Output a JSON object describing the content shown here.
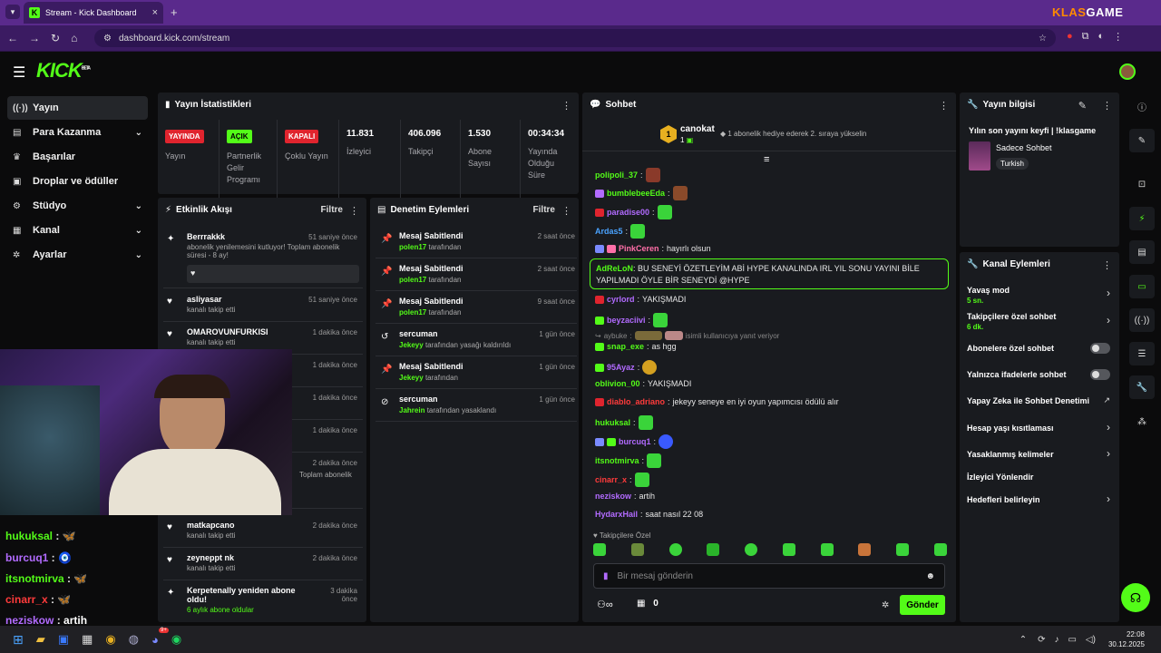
{
  "browser": {
    "tab_title": "Stream - Kick Dashboard",
    "url": "dashboard.kick.com/stream",
    "watermark_a": "KLAS",
    "watermark_b": "GAME"
  },
  "brand": {
    "logo": "KICK",
    "beta": "BETA",
    "accent": "#53fc18"
  },
  "sidebar": {
    "items": [
      {
        "label": "Yayın",
        "icon": "broadcast-icon"
      },
      {
        "label": "Para Kazanma",
        "icon": "money-icon"
      },
      {
        "label": "Başarılar",
        "icon": "trophy-icon"
      },
      {
        "label": "Droplar ve ödüller",
        "icon": "gift-icon"
      },
      {
        "label": "Stüdyo",
        "icon": "studio-icon"
      },
      {
        "label": "Kanal",
        "icon": "channel-icon"
      },
      {
        "label": "Ayarlar",
        "icon": "gear-icon"
      }
    ]
  },
  "stats": {
    "title": "Yayın İstatistikleri",
    "live_badge": "YAYINDA",
    "live_label": "Yayın",
    "partner_badge": "AÇIK",
    "partner_label": "Partnerlik Gelir Programı",
    "multi_badge": "KAPALI",
    "multi_label": "Çoklu Yayın",
    "viewers": "11.831",
    "viewers_label": "İzleyici",
    "followers": "406.096",
    "followers_label": "Takipçi",
    "subs": "1.530",
    "subs_label": "Abone Sayısı",
    "uptime": "00:34:34",
    "uptime_label": "Yayında Olduğu Süre"
  },
  "activity": {
    "title": "Etkinlik Akışı",
    "filter": "Filtre",
    "rows": [
      {
        "name": "Berrrakkk",
        "sub": "abonelik yenilemesini kutluyor! Toplam abonelik süresi - 8 ay!",
        "time": "51 saniye önce"
      },
      {
        "name": "asliyasar",
        "sub": "kanalı takip etti",
        "time": "51 saniye önce"
      },
      {
        "name": "OMAROVUNFURKISI",
        "sub": "kanalı takip etti",
        "time": "1 dakika önce"
      },
      {
        "name": "",
        "sub": "",
        "time": "1 dakika önce"
      },
      {
        "name": "",
        "sub": "",
        "time": "1 dakika önce"
      },
      {
        "name": "",
        "sub": "",
        "time": "1 dakika önce"
      },
      {
        "name": "",
        "sub": "Toplam abonelik",
        "time": "2 dakika önce"
      },
      {
        "name": "matkapcano",
        "sub": "kanalı takip etti",
        "time": "2 dakika önce"
      },
      {
        "name": "zeyneppt nk",
        "sub": "kanalı takip etti",
        "time": "2 dakika önce"
      },
      {
        "name": "Kerpetenally yeniden abone oldu!",
        "sub": "6 aylık abone oldular",
        "time": "3 dakika önce"
      }
    ]
  },
  "moderation": {
    "title": "Denetim Eylemleri",
    "filter": "Filtre",
    "rows": [
      {
        "name": "Mesaj Sabitlendi",
        "by": "polen17",
        "rest": "tarafından",
        "time": "2 saat önce"
      },
      {
        "name": "Mesaj Sabitlendi",
        "by": "polen17",
        "rest": "tarafından",
        "time": "2 saat önce"
      },
      {
        "name": "Mesaj Sabitlendi",
        "by": "polen17",
        "rest": "tarafından",
        "time": "9 saat önce"
      },
      {
        "name": "sercuman",
        "by": "Jekeyy",
        "rest": "tarafından yasağı kaldırıldı",
        "time": "1 gün önce"
      },
      {
        "name": "Mesaj Sabitlendi",
        "by": "Jekeyy",
        "rest": "tarafından",
        "time": "1 gün önce"
      },
      {
        "name": "sercuman",
        "by": "Jahrein",
        "rest": "tarafından yasaklandı",
        "time": "1 gün önce"
      }
    ]
  },
  "chat": {
    "title": "Sohbet",
    "gifter": "canokat",
    "gifter_count": "1",
    "gift_rank": "1",
    "gift_note": "1 abonelik hediye ederek 2. sıraya yükselin",
    "messages": [
      {
        "user": "polipoli_37",
        "color": "#53fc18",
        "text": ""
      },
      {
        "user": "bumblebeeEda",
        "color": "#53fc18",
        "text": ""
      },
      {
        "user": "paradise00",
        "color": "#b26bff",
        "text": ""
      },
      {
        "user": "Ardas5",
        "color": "#4aa3ff",
        "text": ""
      },
      {
        "user": "PinkCeren",
        "color": "#ff6fa8",
        "text": "hayırlı olsun"
      },
      {
        "user": "AdReLoN",
        "color": "#53fc18",
        "text": "BU SENEYİ ÖZETLEYİM ABİ HYPE KANALINDA IRL YIL SONU YAYINI BİLE YAPILMADI ÖYLE BİR SENEYDİ @HYPE"
      },
      {
        "user": "cyrlord",
        "color": "#b26bff",
        "text": "YAKIŞMADI"
      },
      {
        "user": "beyzaciivi",
        "color": "#b26bff",
        "text": ""
      },
      {
        "user": "aybuke",
        "color": "#888888",
        "text": "isimli kullanıcıya yanıt veriyor"
      },
      {
        "user": "snap_exe",
        "color": "#53fc18",
        "text": "as hgg"
      },
      {
        "user": "95Ayaz",
        "color": "#b26bff",
        "text": ""
      },
      {
        "user": "oblivion_00",
        "color": "#53fc18",
        "text": "YAKIŞMADI"
      },
      {
        "user": "diablo_adriano",
        "color": "#ff3b3b",
        "text": "jekeyy seneye en iyi oyun yapımcısı ödülü alır"
      },
      {
        "user": "hukuksal",
        "color": "#53fc18",
        "text": ""
      },
      {
        "user": "burcuq1",
        "color": "#b26bff",
        "text": ""
      },
      {
        "user": "itsnotmirva",
        "color": "#53fc18",
        "text": ""
      },
      {
        "user": "cinarr_x",
        "color": "#ff3b3b",
        "text": ""
      },
      {
        "user": "neziskow",
        "color": "#b26bff",
        "text": "artih"
      },
      {
        "user": "HydarxHail",
        "color": "#b26bff",
        "text": "saat nasıl 22 08"
      }
    ],
    "followers_only": "Takipçilere Özel",
    "placeholder": "Bir mesaj gönderin",
    "points": "0",
    "send": "Gönder"
  },
  "stream_info": {
    "title": "Yayın bilgisi",
    "stream_title": "Yılın son yayını keyfi | !klasgame",
    "category": "Sadece Sohbet",
    "language": "Turkish"
  },
  "channel_actions": {
    "title": "Kanal Eylemleri",
    "slow_mode": "Yavaş mod",
    "slow_mode_val": "5 sn.",
    "followers_chat": "Takipçilere özel sohbet",
    "followers_chat_val": "6 dk.",
    "subs_chat": "Abonelere özel sohbet",
    "emotes_chat": "Yalnızca ifadelerle sohbet",
    "ai_mod": "Yapay Zeka ile Sohbet Denetimi",
    "account_age": "Hesap yaşı kısıtlaması",
    "banned_words": "Yasaklanmış kelimeler",
    "redirect": "İzleyici Yönlendir",
    "goals": "Hedefleri belirleyin"
  },
  "overlay_chat": [
    {
      "user": "hukuksal",
      "color": "#53fc18"
    },
    {
      "user": "burcuq1",
      "color": "#b26bff"
    },
    {
      "user": "itsnotmirva",
      "color": "#53fc18"
    },
    {
      "user": "cinarr_x",
      "color": "#ff3b3b"
    },
    {
      "user": "neziskow",
      "color": "#b26bff",
      "text": "artih"
    }
  ],
  "taskbar": {
    "time": "22:08",
    "date": "30.12.2025",
    "notif": "9+"
  }
}
